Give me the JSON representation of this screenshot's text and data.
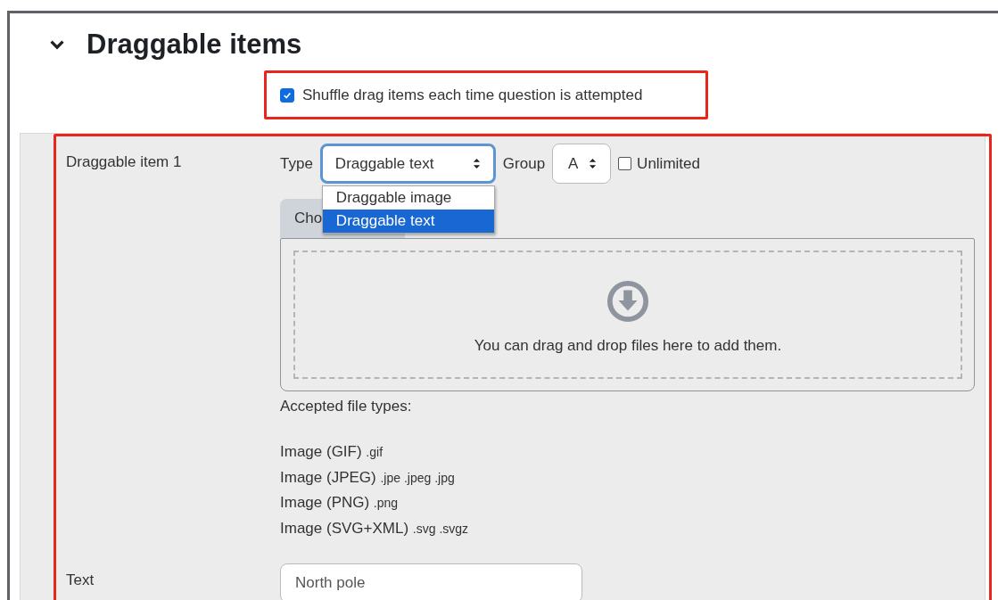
{
  "section": {
    "title": "Draggable items",
    "expanded": true
  },
  "shuffle": {
    "label": "Shuffle drag items each time question is attempted",
    "checked": true
  },
  "item": {
    "label": "Draggable item 1",
    "type_label": "Type",
    "type_value": "Draggable text",
    "type_options": [
      {
        "label": "Draggable image",
        "selected": false
      },
      {
        "label": "Draggable text",
        "selected": true
      }
    ],
    "group_label": "Group",
    "group_value": "A",
    "unlimited": {
      "label": "Unlimited",
      "checked": false
    },
    "choose_button": "Cho",
    "dropzone_text": "You can drag and drop files here to add them.",
    "accepted_label": "Accepted file types:",
    "file_types": [
      {
        "name": "Image (GIF)",
        "extensions": ".gif"
      },
      {
        "name": "Image (JPEG)",
        "extensions": ".jpe .jpeg .jpg"
      },
      {
        "name": "Image (PNG)",
        "extensions": ".png"
      },
      {
        "name": "Image (SVG+XML)",
        "extensions": ".svg .svgz"
      }
    ],
    "text_label": "Text",
    "text_value": "North pole"
  }
}
